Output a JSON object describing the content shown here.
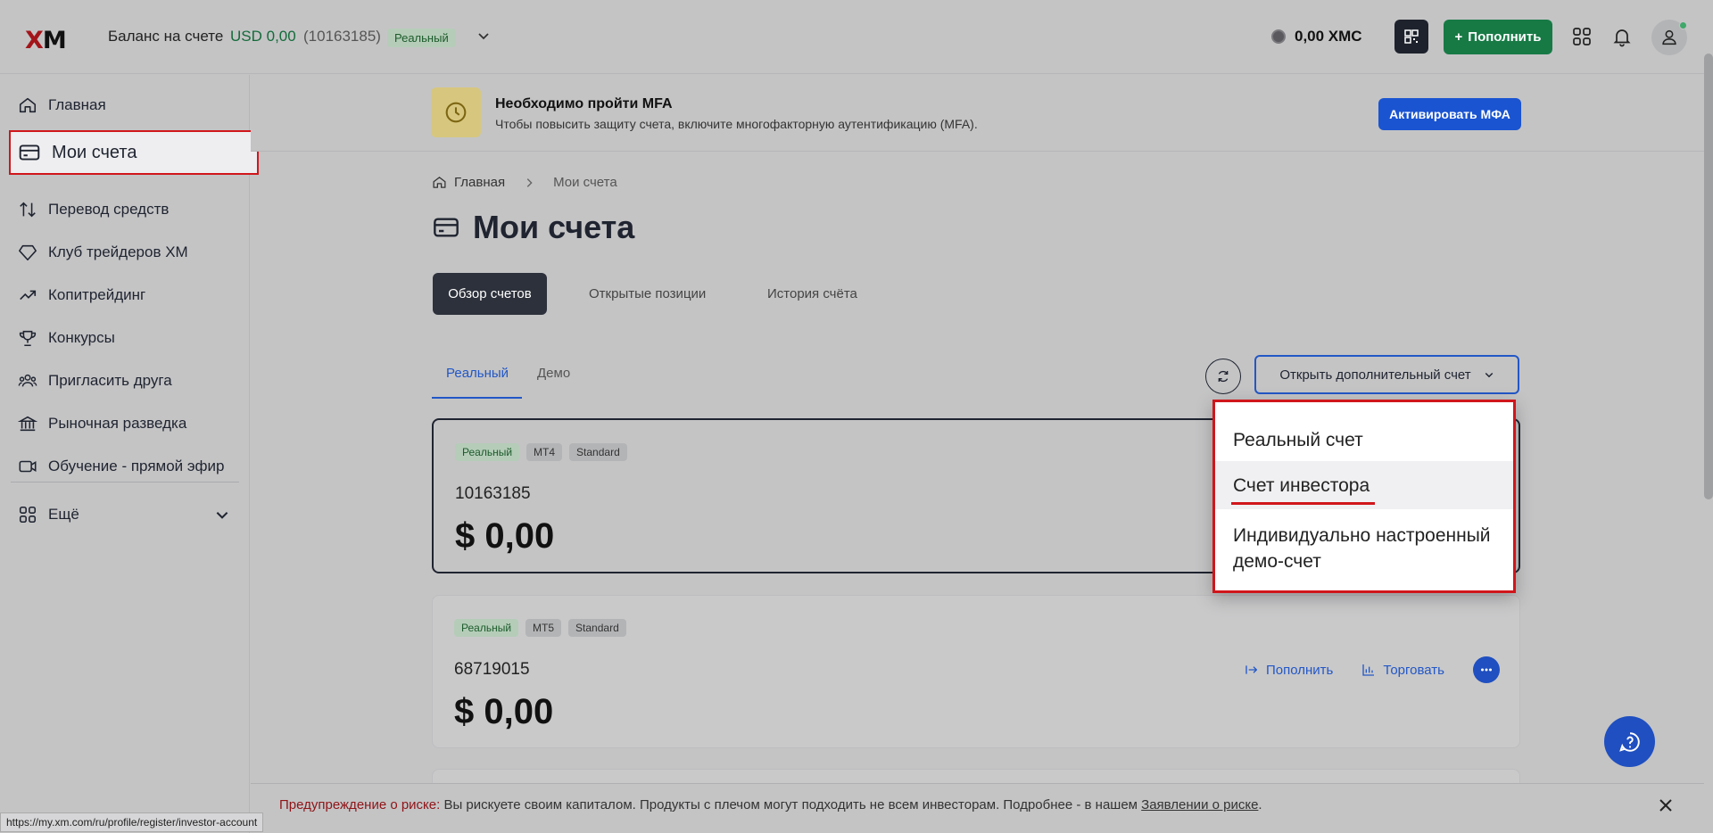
{
  "header": {
    "logo_x": "X",
    "logo_m": "M",
    "balance_label": "Баланс на счете",
    "balance_value": "USD 0,00",
    "account_id": "(10163185)",
    "account_type_badge": "Реальный",
    "xmc_balance": "0,00 XMC",
    "deposit_label": "Пополнить"
  },
  "sidebar": {
    "items": [
      {
        "label": "Главная",
        "icon": "home-icon"
      },
      {
        "label": "Мои счета",
        "icon": "card-icon"
      },
      {
        "label": "Перевод средств",
        "icon": "transfer-icon"
      },
      {
        "label": "Клуб трейдеров XM",
        "icon": "diamond-icon"
      },
      {
        "label": "Копитрейдинг",
        "icon": "trend-icon"
      },
      {
        "label": "Конкурсы",
        "icon": "trophy-icon"
      },
      {
        "label": "Пригласить друга",
        "icon": "users-icon"
      },
      {
        "label": "Рыночная разведка",
        "icon": "bank-icon"
      },
      {
        "label": "Обучение - прямой эфир",
        "icon": "video-icon"
      }
    ],
    "more_label": "Ещё"
  },
  "mfa": {
    "title": "Необходимо пройти MFA",
    "description": "Чтобы повысить защиту счета, включите многофакторную аутентификацию (MFA).",
    "button": "Активировать МФА"
  },
  "breadcrumb": {
    "home": "Главная",
    "current": "Мои счета"
  },
  "page": {
    "title": "Мои счета",
    "tabs": [
      "Обзор счетов",
      "Открытые позиции",
      "История счёта"
    ],
    "subtabs": [
      "Реальный",
      "Демо"
    ],
    "open_account_button": "Открыть дополнительный счет"
  },
  "dropdown": {
    "items": [
      "Реальный счет",
      "Счет инвестора",
      "Индивидуально настроенный демо-счет"
    ]
  },
  "accounts": [
    {
      "type": "Реальный",
      "platform": "MT4",
      "kind": "Standard",
      "number": "10163185",
      "amount": "$ 0,00"
    },
    {
      "type": "Реальный",
      "platform": "MT5",
      "kind": "Standard",
      "number": "68719015",
      "amount": "$ 0,00",
      "action_deposit": "Пополнить",
      "action_trade": "Торговать"
    }
  ],
  "risk": {
    "warning": "Предупреждение о риске:",
    "text": " Вы рискуете своим капиталом. Продукты с плечом могут подходить не всем инвесторам. Подробнее - в нашем ",
    "link": "Заявлении о риске",
    "end": "."
  },
  "status_url": "https://my.xm.com/ru/profile/register/investor-account",
  "colors": {
    "accent_blue": "#2257c6",
    "deposit_green": "#177a45",
    "highlight_red": "#d0161b"
  }
}
